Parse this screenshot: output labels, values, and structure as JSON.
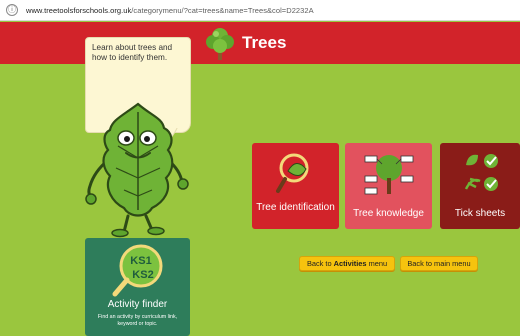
{
  "browser": {
    "info_icon": "ⓘ",
    "url_domain": "www.treetoolsforschools.org.uk",
    "url_path": "/categorymenu/?cat=trees&name=Trees&col=D2232A"
  },
  "header": {
    "title": "Trees",
    "background": "#d2232a"
  },
  "intro": {
    "text": "Learn about trees and how to identify them."
  },
  "tiles": [
    {
      "label": "Tree identification",
      "icon": "magnifier-leaf-icon",
      "color": "#d2232a"
    },
    {
      "label": "Tree knowledge",
      "icon": "tree-diagram-icon",
      "color": "#e2525e"
    },
    {
      "label": "Tick sheets",
      "icon": "leaf-tick-icon",
      "color": "#8a1c18"
    }
  ],
  "buttons": {
    "back_activities_prefix": "Back to ",
    "back_activities_bold": "Activities",
    "back_activities_suffix": " menu",
    "back_main": "Back to main menu"
  },
  "finder": {
    "title": "Activity finder",
    "description": "Find an activity by curriculum link, keyword or topic.",
    "badge_top": "KS1",
    "badge_bottom": "KS2"
  },
  "colors": {
    "page": "#9ac63e",
    "button": "#f6c30e",
    "finder": "#2e7d5b"
  }
}
